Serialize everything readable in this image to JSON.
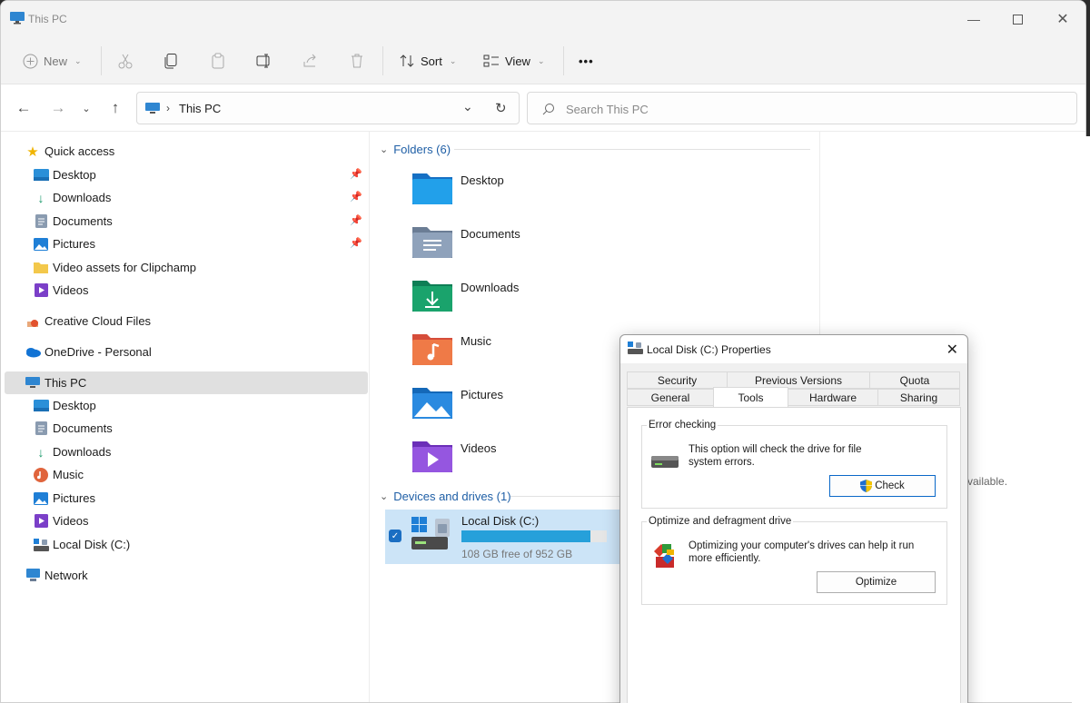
{
  "window": {
    "title": "This PC"
  },
  "toolbar": {
    "new_label": "New",
    "sort_label": "Sort",
    "view_label": "View",
    "more_label": "•••"
  },
  "address": {
    "crumb": "This PC"
  },
  "search": {
    "placeholder": "Search This PC"
  },
  "sidebar": {
    "quick_access": "Quick access",
    "qa_items": [
      {
        "label": "Desktop"
      },
      {
        "label": "Downloads"
      },
      {
        "label": "Documents"
      },
      {
        "label": "Pictures"
      },
      {
        "label": "Video assets for Clipchamp"
      },
      {
        "label": "Videos"
      }
    ],
    "creative_cloud": "Creative Cloud Files",
    "onedrive": "OneDrive - Personal",
    "this_pc": "This PC",
    "pc_items": [
      {
        "label": "Desktop"
      },
      {
        "label": "Documents"
      },
      {
        "label": "Downloads"
      },
      {
        "label": "Music"
      },
      {
        "label": "Pictures"
      },
      {
        "label": "Videos"
      },
      {
        "label": "Local Disk (C:)"
      }
    ],
    "network": "Network"
  },
  "main": {
    "folders_header": "Folders (6)",
    "folders": [
      {
        "name": "Desktop"
      },
      {
        "name": "Documents"
      },
      {
        "name": "Downloads"
      },
      {
        "name": "Music"
      },
      {
        "name": "Pictures"
      },
      {
        "name": "Videos"
      }
    ],
    "drives_header": "Devices and drives (1)",
    "drive": {
      "name": "Local Disk (C:)",
      "free_text": "108 GB free of 952 GB",
      "used_fraction": 0.887
    }
  },
  "right_pane": {
    "text": "vailable."
  },
  "dialog": {
    "title": "Local Disk (C:) Properties",
    "tabs_row1": [
      "Security",
      "Previous Versions",
      "Quota"
    ],
    "tabs_row2": [
      "General",
      "Tools",
      "Hardware",
      "Sharing"
    ],
    "error_checking": {
      "title": "Error checking",
      "text_line1": "This option will check the drive for file",
      "text_line2": "system errors.",
      "button": "Check"
    },
    "optimize": {
      "title": "Optimize and defragment drive",
      "text_line1": "Optimizing your computer's drives can help it run",
      "text_line2": "more efficiently.",
      "button": "Optimize"
    }
  },
  "colors": {
    "accent": "#1b6ec2",
    "selection": "#cce4f7",
    "drive_bar": "#26a0da"
  }
}
